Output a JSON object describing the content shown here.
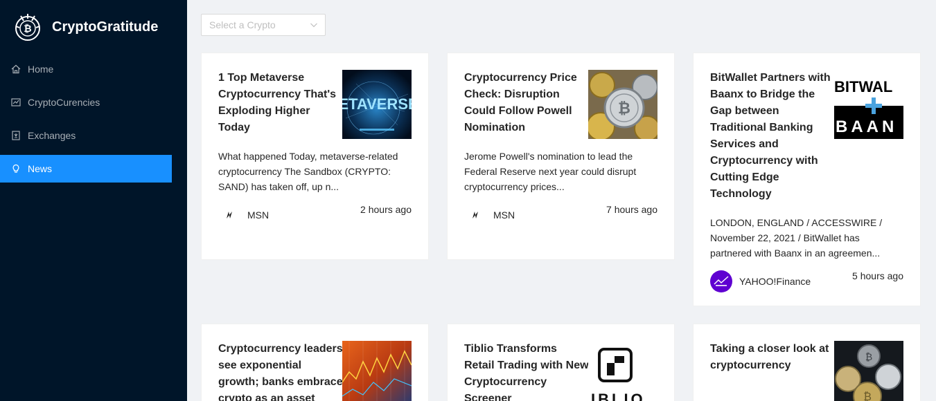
{
  "brand": {
    "name": "CryptoGratitude",
    "logo_icon": "crypto-coin-logo-icon"
  },
  "menu": [
    {
      "label": "Home",
      "icon": "home-icon",
      "active": false
    },
    {
      "label": "CryptoCurencies",
      "icon": "chart-icon",
      "active": false
    },
    {
      "label": "Exchanges",
      "icon": "exchange-icon",
      "active": false
    },
    {
      "label": "News",
      "icon": "bulb-icon",
      "active": true
    }
  ],
  "filter": {
    "placeholder": "Select a Crypto"
  },
  "colors": {
    "sidebar": "#001529",
    "accent": "#1890ff",
    "background": "#f0f2f5"
  },
  "news": [
    {
      "title": "1 Top Metaverse Cryptocurrency That's Exploding Higher Today",
      "description": "What happened Today, metaverse-related cryptocurrency The Sandbox (CRYPTO: SAND) has taken off, up n...",
      "provider": "MSN",
      "time": "2 hours ago",
      "thumb_text": "ETAVERSE"
    },
    {
      "title": "Cryptocurrency Price Check: Disruption Could Follow Powell Nomination",
      "description": "Jerome Powell's nomination to lead the Federal Reserve next year could disrupt cryptocurrency prices...",
      "provider": "MSN",
      "time": "7 hours ago"
    },
    {
      "title": "BitWallet Partners with Baanx to Bridge the Gap between Traditional Banking Services and Cryptocurrency with Cutting Edge Technology",
      "description": "LONDON, ENGLAND / ACCESSWIRE / November 22, 2021 / BitWallet has partnered with Baanx in an agreemen...",
      "provider": "YAHOO!Finance",
      "time": "5 hours ago",
      "thumb_text_top": "BITWAL",
      "thumb_text_bottom": "BAAN"
    },
    {
      "title": "Cryptocurrency leaders see exponential growth; banks embrace crypto as an asset"
    },
    {
      "title": "Tiblio Transforms Retail Trading with New Cryptocurrency Screener",
      "thumb_text": "IBLIO"
    },
    {
      "title": "Taking a closer look at cryptocurrency"
    }
  ]
}
